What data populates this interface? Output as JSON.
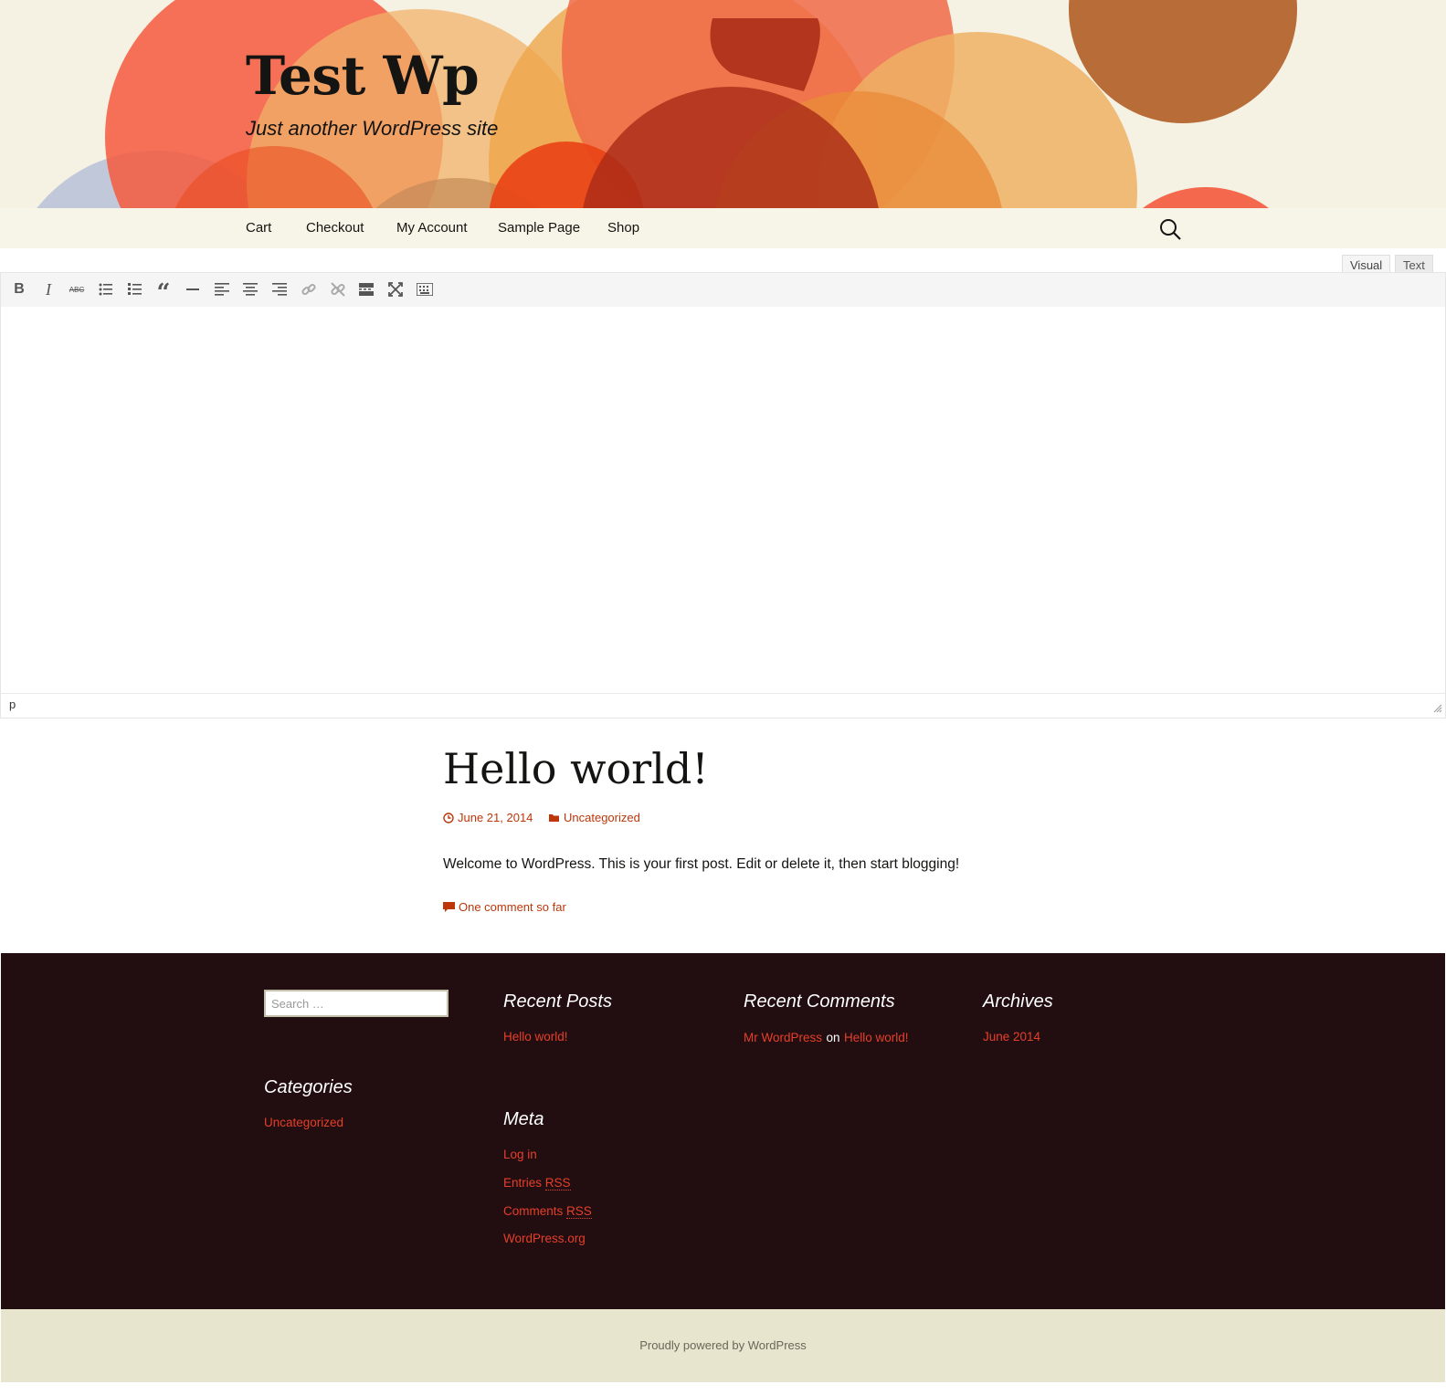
{
  "header": {
    "site_title": "Test Wp",
    "tagline": "Just another WordPress site",
    "background_color": "#f5f2e4"
  },
  "nav": {
    "items": [
      {
        "label": "Cart"
      },
      {
        "label": "Checkout"
      },
      {
        "label": "My Account"
      },
      {
        "label": "Sample Page"
      },
      {
        "label": "Shop"
      }
    ],
    "search_icon": "search-icon"
  },
  "editor": {
    "tabs": [
      {
        "label": "Visual",
        "active": true
      },
      {
        "label": "Text",
        "active": false
      }
    ],
    "toolbar": [
      {
        "icon": "bold-icon",
        "glyph": "B"
      },
      {
        "icon": "italic-icon",
        "glyph": "I"
      },
      {
        "icon": "strikethrough-icon",
        "glyph": "ABC"
      },
      {
        "icon": "bulleted-list-icon"
      },
      {
        "icon": "numbered-list-icon"
      },
      {
        "icon": "blockquote-icon",
        "glyph": "“"
      },
      {
        "icon": "horizontal-line-icon"
      },
      {
        "icon": "align-left-icon"
      },
      {
        "icon": "align-center-icon"
      },
      {
        "icon": "align-right-icon"
      },
      {
        "icon": "link-icon"
      },
      {
        "icon": "unlink-icon"
      },
      {
        "icon": "read-more-icon"
      },
      {
        "icon": "fullscreen-icon"
      },
      {
        "icon": "toolbar-toggle-icon"
      }
    ],
    "path": "p"
  },
  "post": {
    "title": "Hello world!",
    "date": "June 21, 2014",
    "category": "Uncategorized",
    "content": "Welcome to WordPress. This is your first post. Edit or delete it, then start blogging!",
    "comments_link": "One comment so far"
  },
  "footer": {
    "search_placeholder": "Search …",
    "recent_posts": {
      "title": "Recent Posts",
      "items": [
        "Hello world!"
      ]
    },
    "recent_comments": {
      "title": "Recent Comments",
      "author": "Mr WordPress",
      "on": "on",
      "post": "Hello world!"
    },
    "archives": {
      "title": "Archives",
      "items": [
        "June 2014"
      ]
    },
    "categories": {
      "title": "Categories",
      "items": [
        "Uncategorized"
      ]
    },
    "meta": {
      "title": "Meta",
      "log_in": "Log in",
      "entries_prefix": "Entries ",
      "comments_prefix": "Comments ",
      "rss": "RSS",
      "wordpress_org": "WordPress.org"
    },
    "powered_by": "Proudly powered by WordPress"
  },
  "colors": {
    "accent": "#bc360a",
    "footer_link": "#e63f2a",
    "footer_bg": "#220e10",
    "site_info_bg": "#e8e5ce",
    "nav_bg": "#f7f5e7"
  }
}
